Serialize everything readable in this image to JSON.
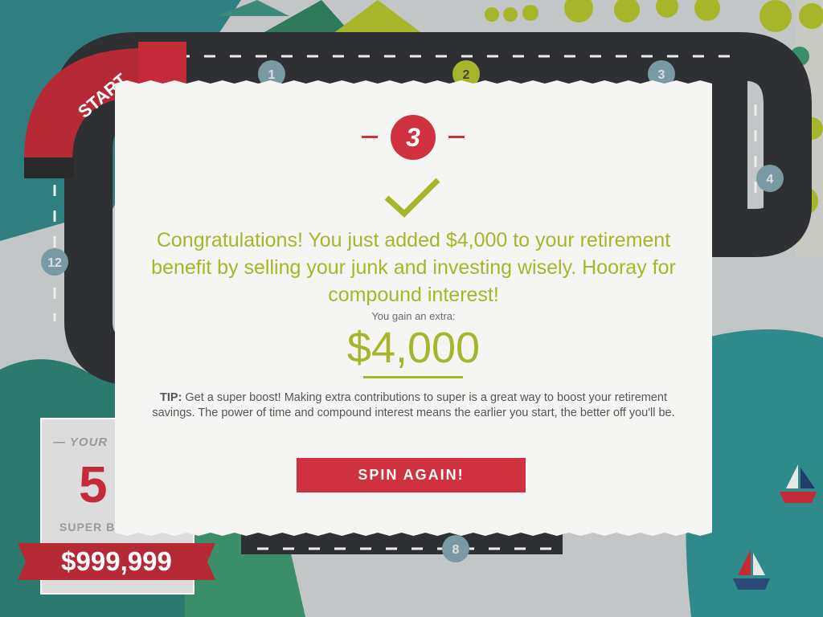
{
  "board": {
    "start_label": "START",
    "space_numbers": [
      "1",
      "2",
      "3",
      "4",
      "8",
      "12"
    ],
    "colors": {
      "road": "#2f3033",
      "accent_red": "#d0313f",
      "olive": "#a7b52a"
    }
  },
  "score_panel": {
    "label": "— YOUR",
    "value": "5",
    "sub_label": "SUPER B",
    "balance": "$999,999"
  },
  "modal": {
    "step_number": "3",
    "check_icon": "checkmark-icon",
    "message": "Congratulations! You just added $4,000 to your retirement benefit by selling your junk and investing wisely. Hooray for compound interest!",
    "gain_label": "You gain an extra:",
    "gain_amount": "$4,000",
    "tip_label": "TIP:",
    "tip_text": " Get a super boost! Making extra contributions to super is a great way to boost your retirement savings. The power of time and compound interest means the earlier you start, the better off you'll be.",
    "button_label": "SPIN AGAIN!"
  }
}
